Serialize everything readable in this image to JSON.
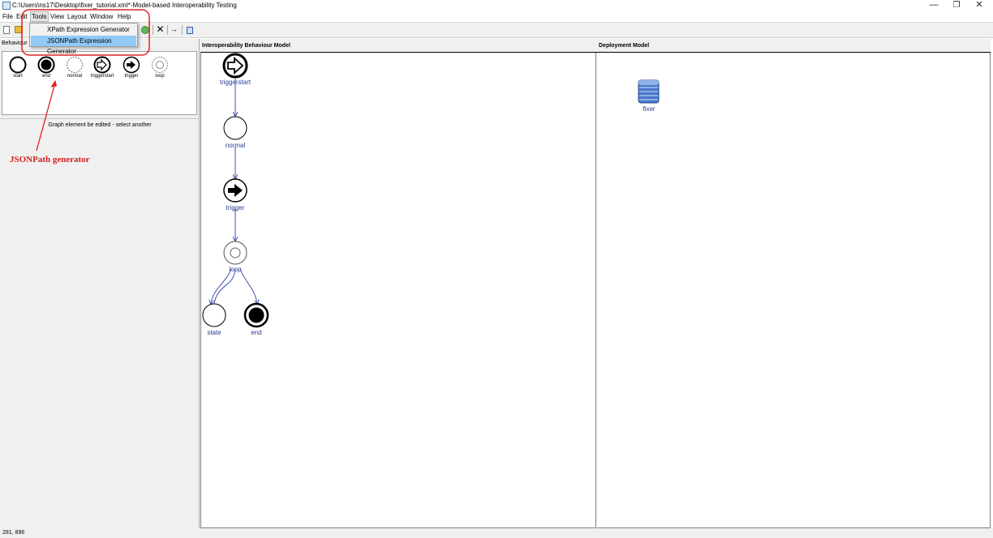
{
  "window": {
    "title": "C:\\Users\\ns17\\Desktop\\fixer_tutorial.xml*-Model-based Interoperability Testing",
    "controls": [
      "minimize",
      "restore",
      "close"
    ]
  },
  "menubar": {
    "items": [
      "File",
      "Edit",
      "Tools",
      "View",
      "Layout",
      "Window",
      "Help"
    ],
    "active": "Tools"
  },
  "tools_menu": {
    "items": [
      "XPath Expression Generator",
      "JSONPath Expression Generator"
    ],
    "selected": "JSONPath Expression Generator"
  },
  "left_panel": {
    "tab_label": "Behaviour",
    "palette": [
      "start",
      "end",
      "normal",
      "triggerstart",
      "trigger",
      "loop"
    ],
    "message": "Graph element be edited - select another"
  },
  "annotation": {
    "text": "JSONPath generator",
    "color": "#d41f1f"
  },
  "behaviour_model": {
    "title": "Interoperability Behaviour Model",
    "nodes": [
      "triggerstart",
      "normal",
      "trigger",
      "loop",
      "state",
      "end"
    ],
    "edge_color": "#4050b0",
    "label_color": "#2a3b96"
  },
  "deployment_model": {
    "title": "Deployment Model",
    "nodes": [
      "fixer"
    ]
  },
  "statusbar": {
    "coords": "281, 896"
  }
}
